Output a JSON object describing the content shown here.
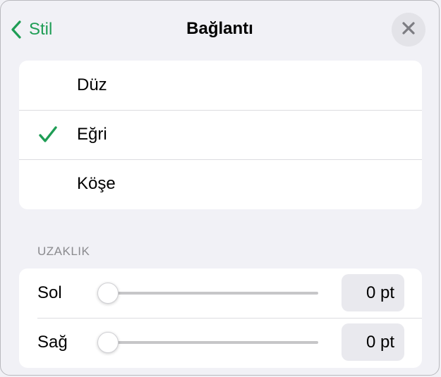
{
  "header": {
    "back_label": "Stil",
    "title": "Bağlantı"
  },
  "connection_types": [
    {
      "label": "Düz",
      "selected": false
    },
    {
      "label": "Eğri",
      "selected": true
    },
    {
      "label": "Köşe",
      "selected": false
    }
  ],
  "distance": {
    "section_title": "UZAKLIK",
    "rows": [
      {
        "label": "Sol",
        "value": "0 pt",
        "slider_level": 0
      },
      {
        "label": "Sağ",
        "value": "0 pt",
        "slider_level": 0
      }
    ]
  },
  "colors": {
    "accent": "#1f9d55",
    "background": "#f1f1f6",
    "card": "#ffffff"
  },
  "icons": {
    "back": "chevron-left-icon",
    "close": "close-icon",
    "selected": "checkmark-icon"
  }
}
